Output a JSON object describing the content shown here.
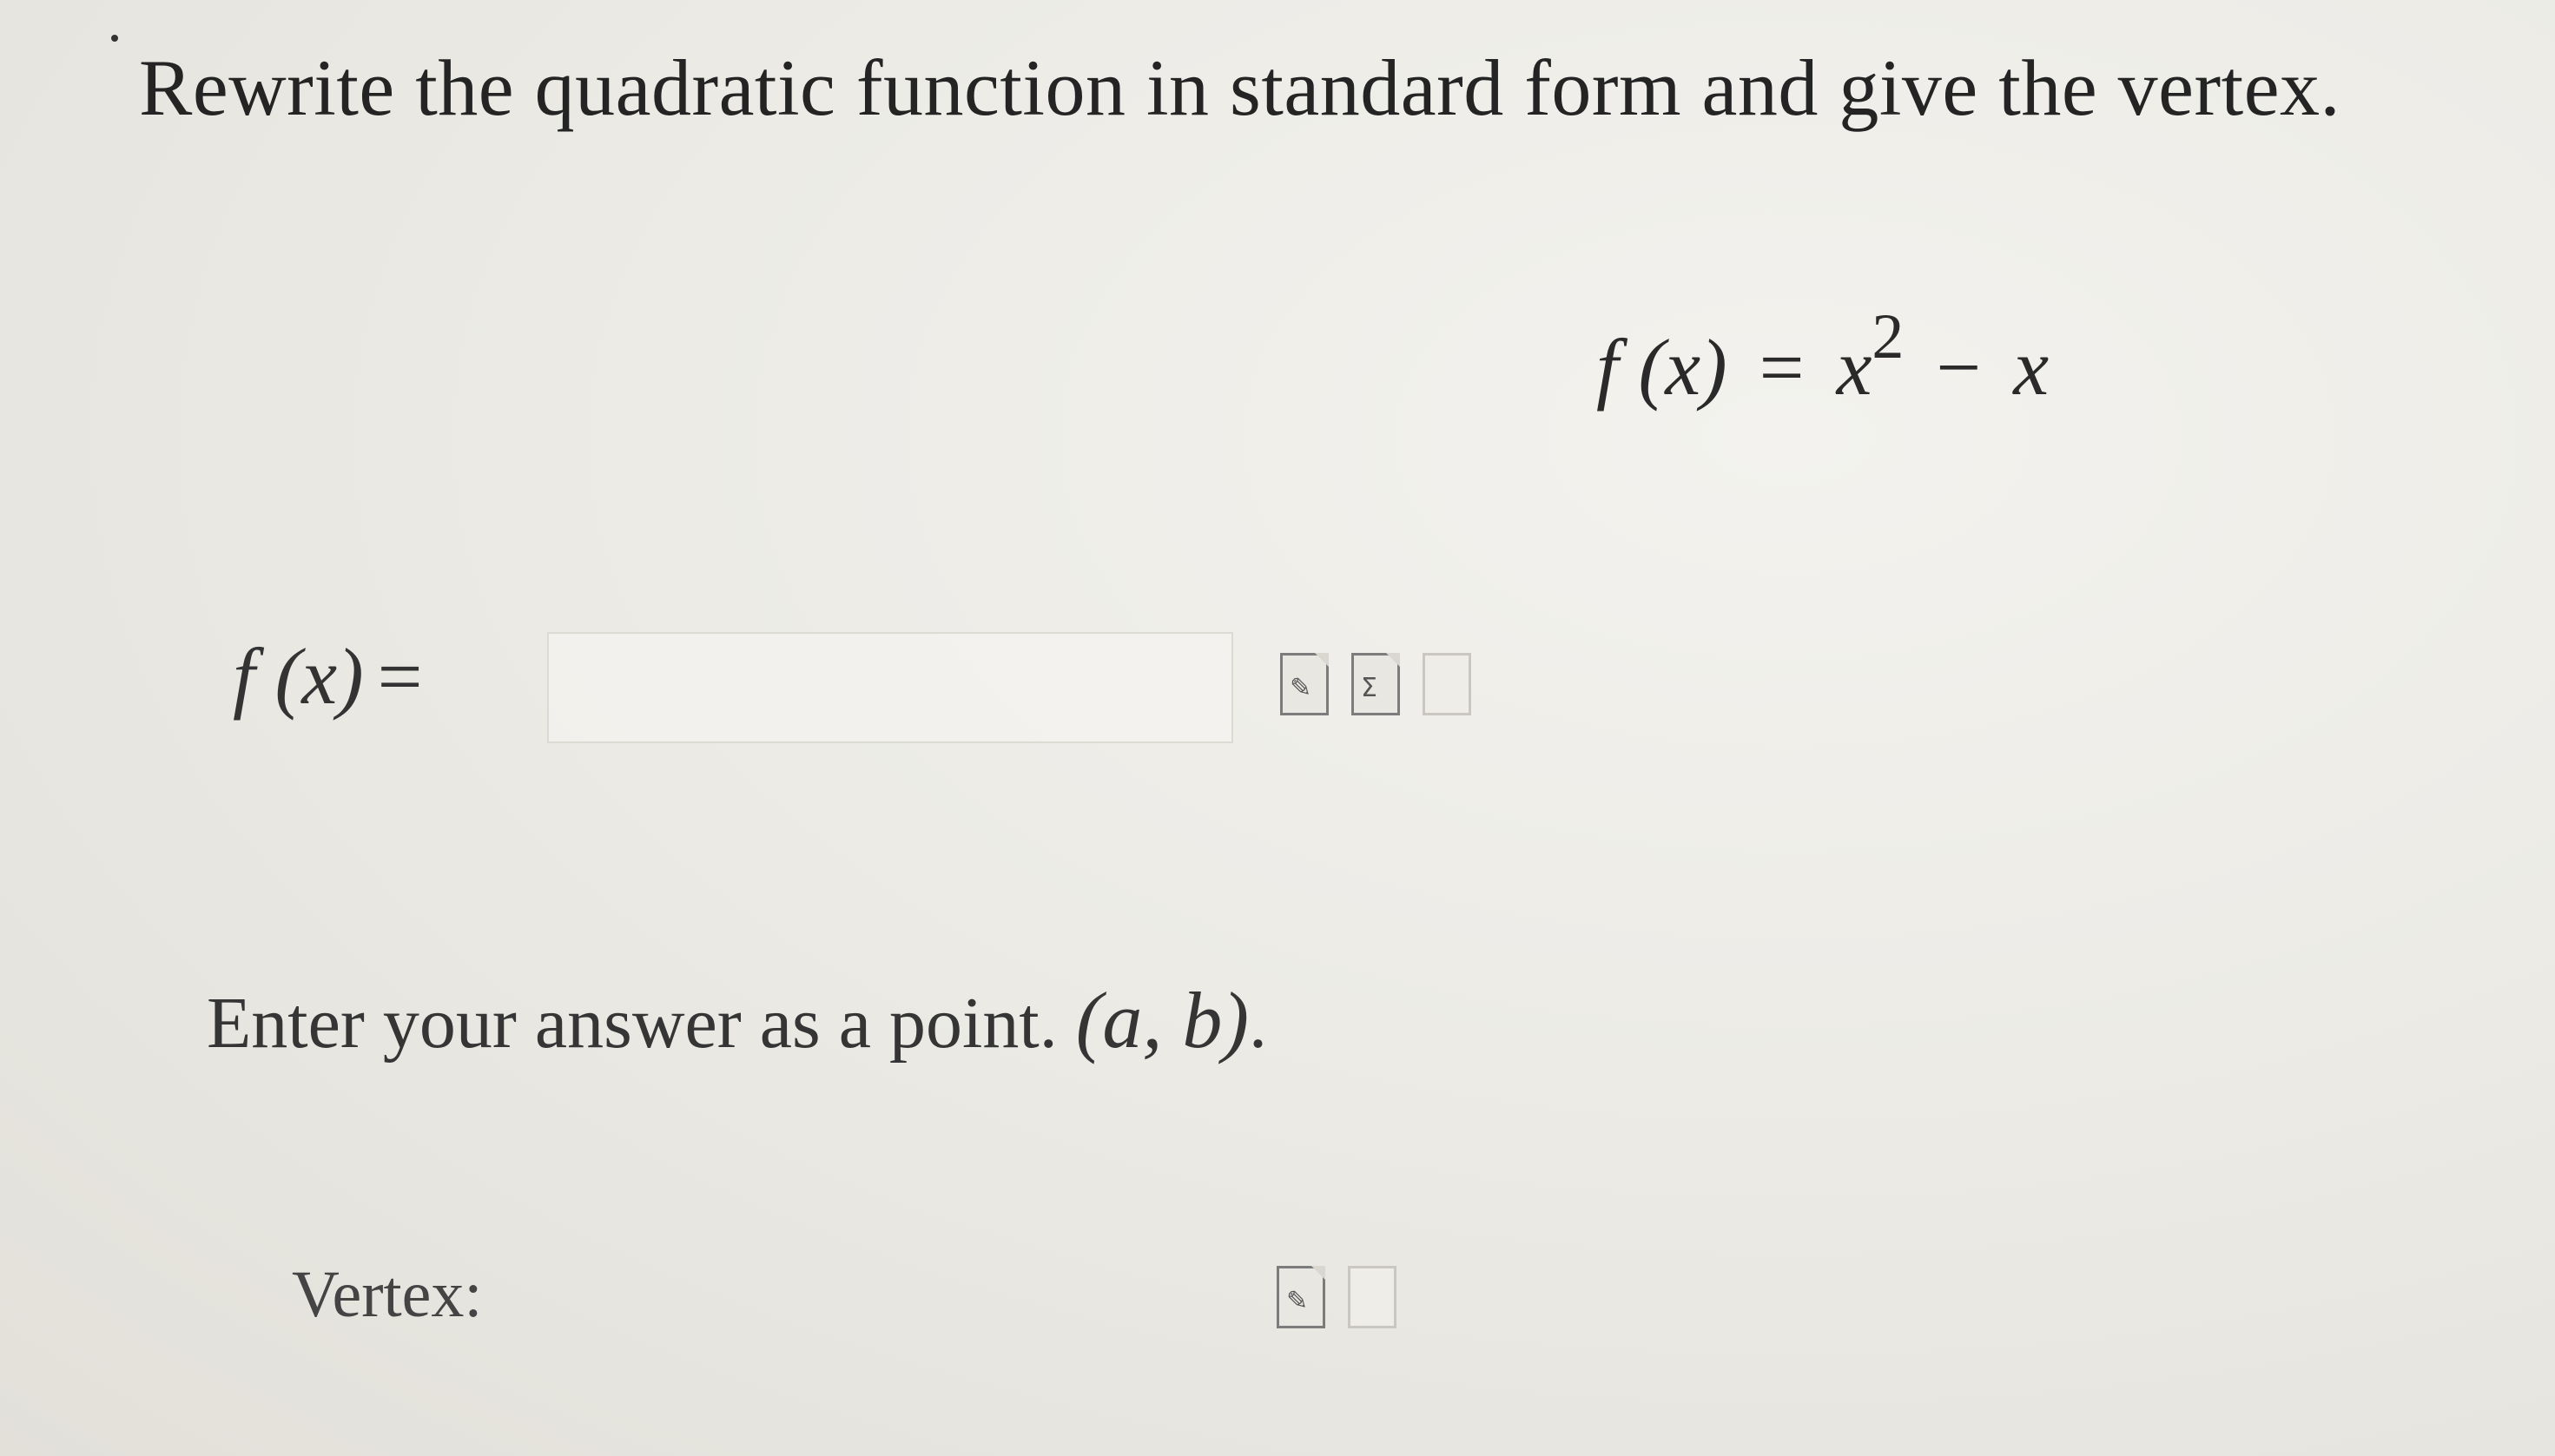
{
  "question": {
    "instruction": "Rewrite the quadratic function in standard form and give the vertex."
  },
  "given": {
    "lhs": "f (x)",
    "equals": "=",
    "term1_base": "x",
    "term1_exp": "2",
    "minus": "−",
    "term2": "x"
  },
  "answer_fx": {
    "label": "f (x)",
    "equals": "=",
    "value": ""
  },
  "hint": {
    "text": "Enter your answer as a point. ",
    "point": "(a, b)",
    "end": "."
  },
  "vertex": {
    "label": "Vertex:",
    "value": ""
  },
  "icons": {
    "edit": "edit-math-icon",
    "preview": "preview-icon",
    "help": "help-icon"
  }
}
